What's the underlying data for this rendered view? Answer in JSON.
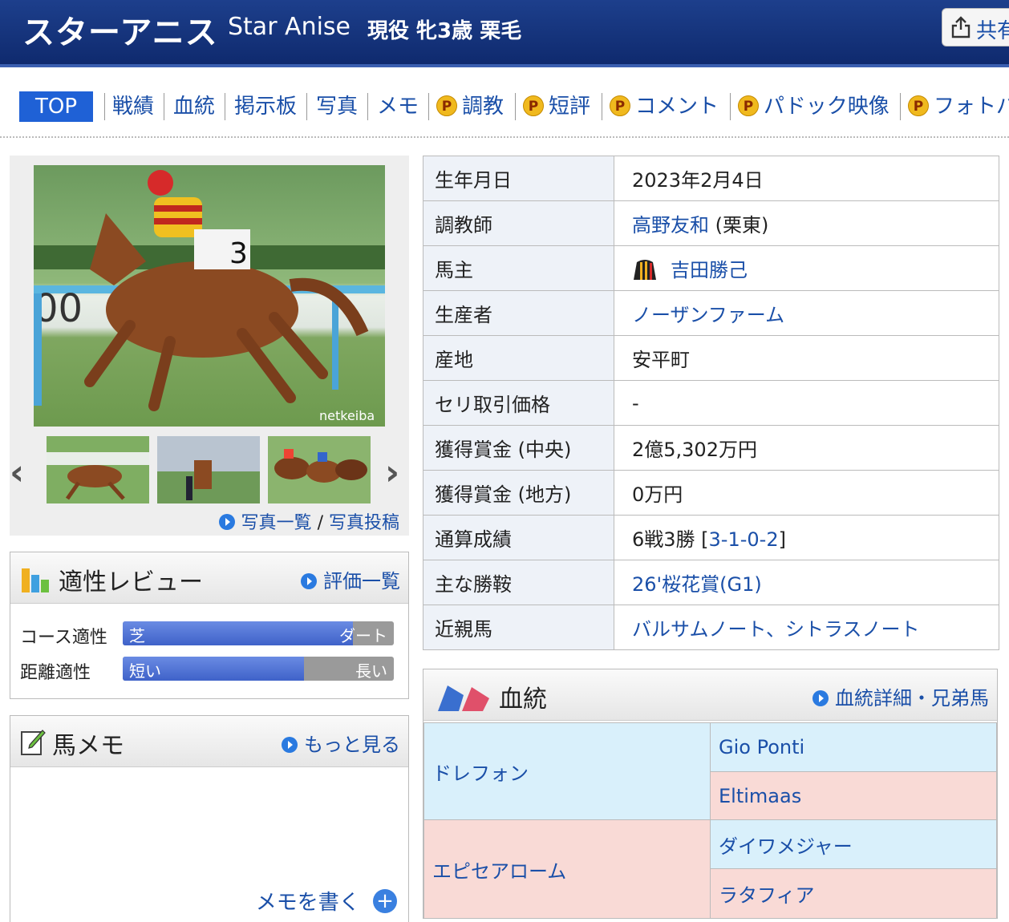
{
  "header": {
    "horse_name": "スターアニス",
    "horse_name_en": "Star Anise",
    "status": "現役 牝3歳 栗毛",
    "share_label": "共有"
  },
  "nav": {
    "items": [
      {
        "label": "TOP",
        "premium": false,
        "active": true
      },
      {
        "label": "戦績",
        "premium": false
      },
      {
        "label": "血統",
        "premium": false
      },
      {
        "label": "掲示板",
        "premium": false
      },
      {
        "label": "写真",
        "premium": false
      },
      {
        "label": "メモ",
        "premium": false
      },
      {
        "label": "調教",
        "premium": true
      },
      {
        "label": "短評",
        "premium": true
      },
      {
        "label": "コメント",
        "premium": true
      },
      {
        "label": "パドック映像",
        "premium": true
      },
      {
        "label": "フォトパ",
        "premium": true
      }
    ],
    "premium_badge": "P"
  },
  "photo": {
    "watermark": "netkeiba",
    "list_link": "写真一覧",
    "separator": "/",
    "post_link": "写真投稿"
  },
  "review": {
    "title": "適性レビュー",
    "link": "評価一覧",
    "course_label": "コース適性",
    "course_left": "芝",
    "course_right": "ダート",
    "course_value": 0.85,
    "distance_label": "距離適性",
    "distance_left": "短い",
    "distance_right": "長い",
    "distance_value": 0.67
  },
  "memo": {
    "title": "馬メモ",
    "link": "もっと見る",
    "write": "メモを書く"
  },
  "profile": {
    "rows": [
      {
        "key": "生年月日",
        "value": "2023年2月4日"
      },
      {
        "key": "調教師",
        "link": "高野友和",
        "suffix": " (栗東)"
      },
      {
        "key": "馬主",
        "link": "吉田勝己",
        "silks": true
      },
      {
        "key": "生産者",
        "link": "ノーザンファーム"
      },
      {
        "key": "産地",
        "value": "安平町"
      },
      {
        "key": "セリ取引価格",
        "value": "-"
      },
      {
        "key": "獲得賞金 (中央)",
        "value": "2億5,302万円"
      },
      {
        "key": "獲得賞金 (地方)",
        "value": "0万円"
      },
      {
        "key": "通算成績",
        "value": "6戦3勝 [",
        "link": "3-1-0-2",
        "suffix": "]"
      },
      {
        "key": "主な勝鞍",
        "link": "26'桜花賞(G1)"
      },
      {
        "key": "近親馬",
        "link": "バルサムノート、シトラスノート"
      }
    ]
  },
  "pedigree": {
    "title": "血統",
    "link": "血統詳細・兄弟馬",
    "sire": "ドレフォン",
    "sire_sire": "Gio Ponti",
    "sire_dam": "Eltimaas",
    "dam": "エピセアローム",
    "dam_sire": "ダイワメジャー",
    "dam_dam": "ラタフィア"
  },
  "colors": {
    "header_bg": "#1d3f8c",
    "link": "#1a4fa8",
    "nav_active": "#1f61d6",
    "sire_bg": "#d9f0fb",
    "dam_bg": "#f9dad6"
  }
}
